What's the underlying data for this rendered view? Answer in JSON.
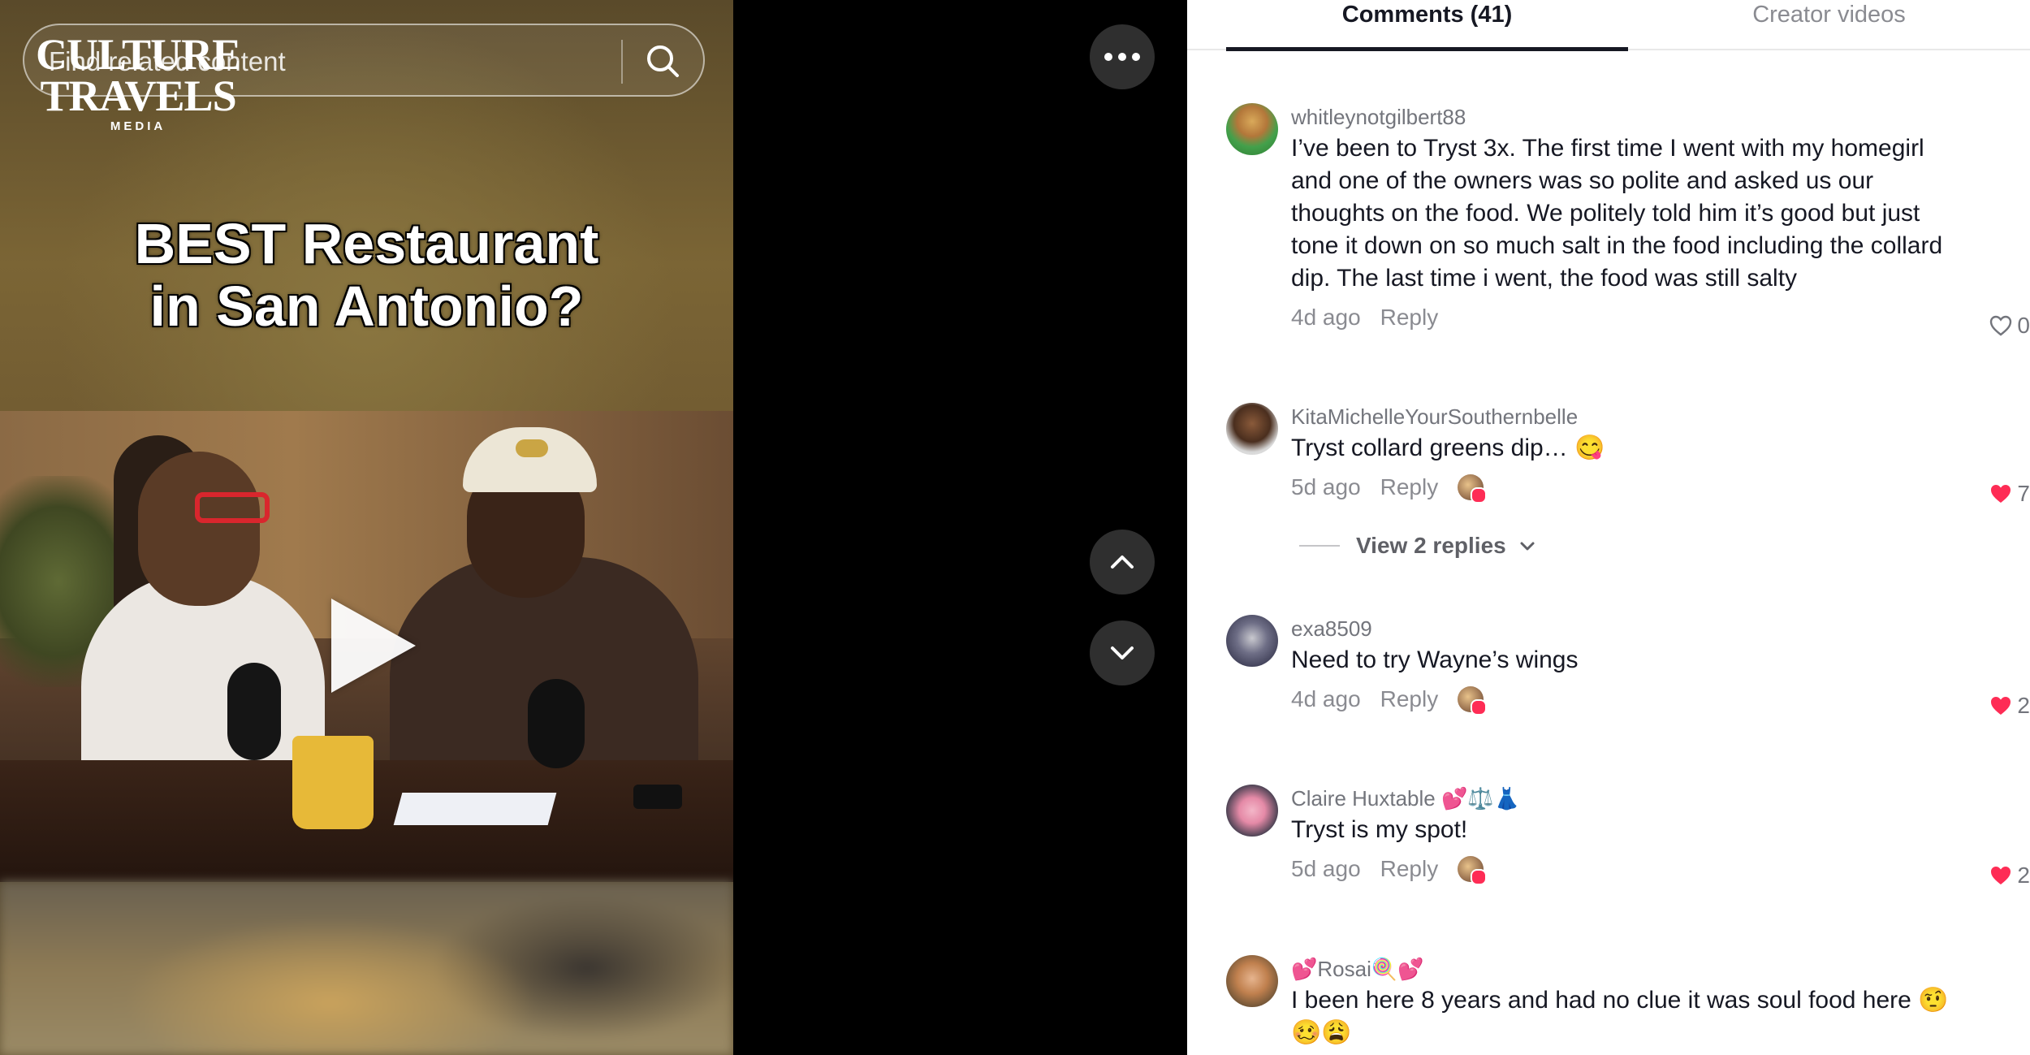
{
  "search": {
    "placeholder": "Find related content"
  },
  "logo": {
    "line1": "CULTURE",
    "line2": "TRAVELS",
    "line3": "MEDIA"
  },
  "video": {
    "title_line1": "BEST Restaurant",
    "title_line2": "in San Antonio?"
  },
  "tabs": {
    "comments": "Comments (41)",
    "creator": "Creator videos"
  },
  "comments": [
    {
      "username": "whitleynotgilbert88",
      "text": "I’ve been to Tryst 3x. The first time I went with my homegirl and one of the owners was so polite and asked us our thoughts on the food. We politely told him it’s good but just tone it down on so much salt in the food including the collard dip. The last time i went, the food was still salty",
      "time": "4d ago",
      "reply": "Reply",
      "likes": "0",
      "liked": false
    },
    {
      "username": "KitaMichelleYourSouthernbelle",
      "text": "Tryst collard greens dip… 😋",
      "time": "5d ago",
      "reply": "Reply",
      "likes": "7",
      "liked": true,
      "view_replies": "View 2 replies"
    },
    {
      "username": "exa8509",
      "text": "Need to try Wayne’s wings",
      "time": "4d ago",
      "reply": "Reply",
      "likes": "2",
      "liked": true
    },
    {
      "username": "Claire Huxtable 💕⚖️👗",
      "text": "Tryst is my spot!",
      "time": "5d ago",
      "reply": "Reply",
      "likes": "2",
      "liked": true
    },
    {
      "username": "💕Rosai🍭💕",
      "text": "I been here 8 years and had no clue it was soul food here 🤨🥴😩",
      "time": "",
      "reply": "",
      "likes": "",
      "liked": false
    }
  ],
  "icons": {
    "more": "more-horizontal-icon",
    "up": "chevron-up-icon",
    "down": "chevron-down-icon",
    "search": "search-icon",
    "heart": "heart-icon",
    "play": "play-icon"
  },
  "colors": {
    "like_red": "#fe2c55",
    "text": "#161823",
    "muted": "#8a8b91"
  }
}
